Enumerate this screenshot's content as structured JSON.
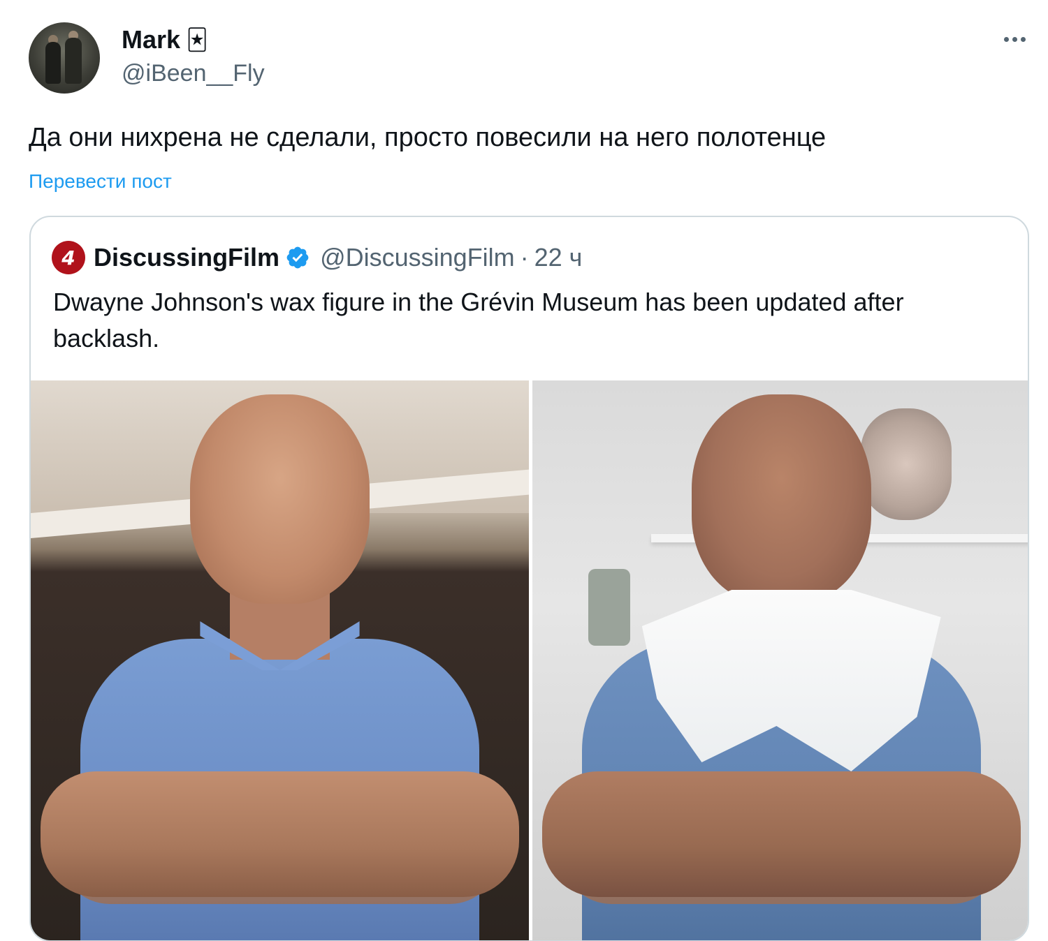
{
  "post": {
    "author_name": "Mark",
    "author_emoji": "🃏",
    "author_handle": "@iBeen__Fly",
    "text": "Да они нихрена не сделали, просто повесили на него полотенце",
    "translate_label": "Перевести пост",
    "more_icon": "more-horizontal-icon"
  },
  "quote": {
    "logo_letter": "4",
    "name": "DiscussingFilm",
    "verified_icon": "verified-badge-icon",
    "handle": "@DiscussingFilm",
    "separator": "·",
    "time": "22 ч",
    "text": "Dwayne Johnson's wax figure in the Grévin Museum has been updated after backlash."
  },
  "colors": {
    "link": "#1d9bf0",
    "secondary_text": "#536471",
    "border": "#cfd9de",
    "verified": "#1d9bf0",
    "logo_bg": "#b0121b"
  }
}
